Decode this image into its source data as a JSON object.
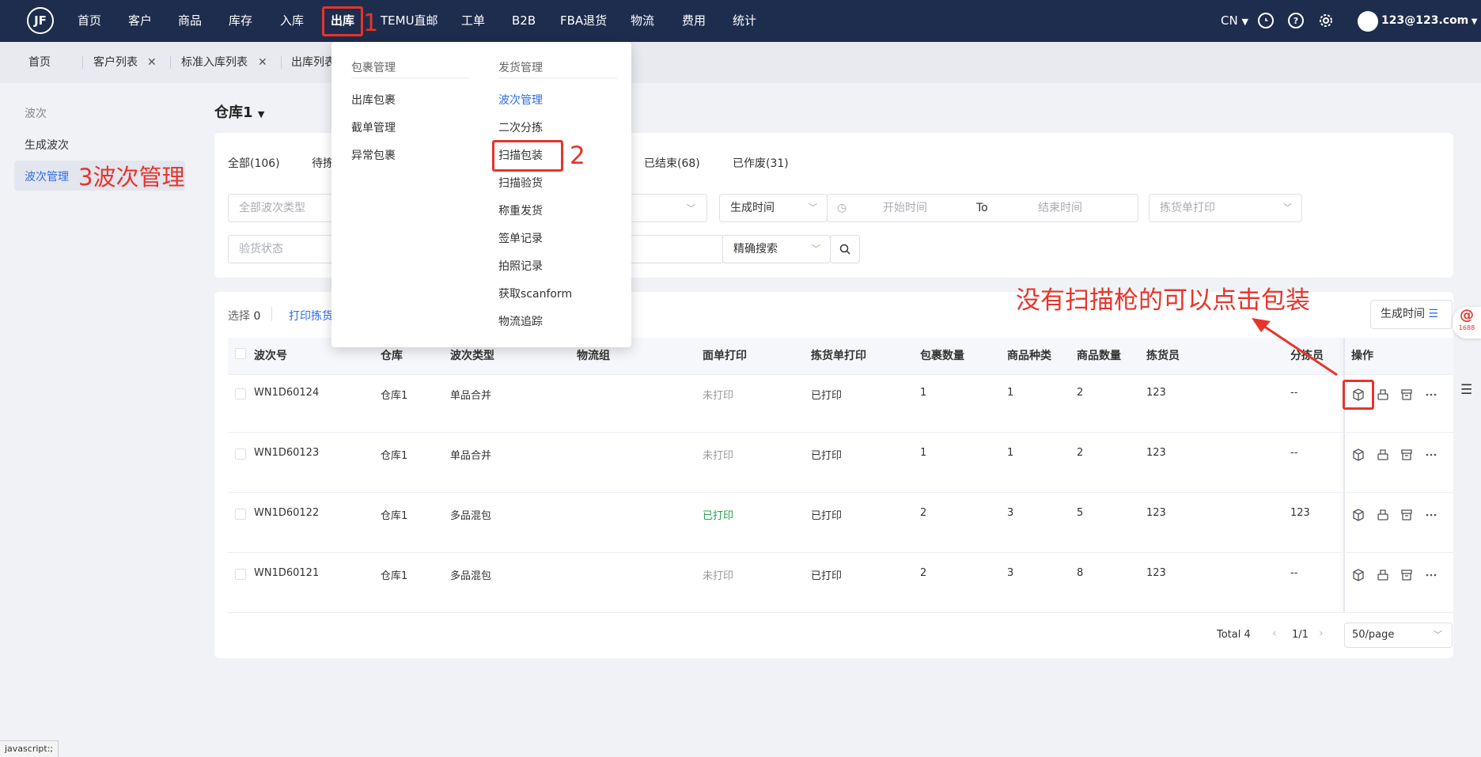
{
  "nav": {
    "logo_text": "JF",
    "items": [
      "首页",
      "客户",
      "商品",
      "库存",
      "入库",
      "出库",
      "TEMU直邮",
      "工单",
      "B2B",
      "FBA退货",
      "物流",
      "费用",
      "统计"
    ],
    "lang": "CN",
    "user": "123@123.com"
  },
  "tabs": [
    {
      "label": "首页",
      "closable": false
    },
    {
      "label": "客户列表",
      "closable": true
    },
    {
      "label": "标准入库列表",
      "closable": true
    },
    {
      "label": "出库列表",
      "closable": false
    }
  ],
  "sidebar": {
    "title": "波次",
    "items": [
      {
        "label": "生成波次",
        "active": false
      },
      {
        "label": "波次管理",
        "active": true
      }
    ]
  },
  "warehouse": "仓库1",
  "status_tabs": [
    "全部(106)",
    "待拣",
    "已结束(68)",
    "已作废(31)"
  ],
  "filters": {
    "wave_type_placeholder": "全部波次类型",
    "time_type": "生成时间",
    "start_placeholder": "开始时间",
    "to": "To",
    "end_placeholder": "结束时间",
    "pick_print_placeholder": "拣货单打印",
    "inspect_placeholder": "验货状态",
    "search_mode": "精确搜索"
  },
  "toolbar": {
    "select_label": "选择",
    "select_count": "0",
    "print_pick": "打印拣货",
    "sort_label": "生成时间"
  },
  "dropdown": {
    "col1": {
      "head": "包裹管理",
      "items": [
        "出库包裹",
        "截单管理",
        "异常包裹"
      ]
    },
    "col2": {
      "head": "发货管理",
      "items": [
        "波次管理",
        "二次分拣",
        "扫描包装",
        "扫描验货",
        "称重发货",
        "签单记录",
        "拍照记录",
        "获取scanform",
        "物流追踪"
      ]
    }
  },
  "table": {
    "headers": [
      "波次号",
      "仓库",
      "波次类型",
      "物流组",
      "面单打印",
      "拣货单打印",
      "包裹数量",
      "商品种类",
      "商品数量",
      "拣货员",
      "分拣员",
      "操作"
    ],
    "rows": [
      {
        "id": "WN1D60124",
        "warehouse": "仓库1",
        "type": "单品合并",
        "group": "",
        "label_print": "未打印",
        "label_status": "unprinted",
        "pick_print": "已打印",
        "packages": "1",
        "kinds": "1",
        "qty": "2",
        "picker": "123",
        "sorter": "--"
      },
      {
        "id": "WN1D60123",
        "warehouse": "仓库1",
        "type": "单品合并",
        "group": "",
        "label_print": "未打印",
        "label_status": "unprinted",
        "pick_print": "已打印",
        "packages": "1",
        "kinds": "1",
        "qty": "2",
        "picker": "123",
        "sorter": "--"
      },
      {
        "id": "WN1D60122",
        "warehouse": "仓库1",
        "type": "多品混包",
        "group": "",
        "label_print": "已打印",
        "label_status": "printed",
        "pick_print": "已打印",
        "packages": "2",
        "kinds": "3",
        "qty": "5",
        "picker": "123",
        "sorter": "123"
      },
      {
        "id": "WN1D60121",
        "warehouse": "仓库1",
        "type": "多品混包",
        "group": "",
        "label_print": "未打印",
        "label_status": "unprinted",
        "pick_print": "已打印",
        "packages": "2",
        "kinds": "3",
        "qty": "8",
        "picker": "123",
        "sorter": "--"
      }
    ]
  },
  "pagination": {
    "total": "Total 4",
    "page": "1/1",
    "per_page": "50/page"
  },
  "annotations": {
    "step1": "1",
    "step2": "2",
    "step3": "3波次管理",
    "note": "没有扫描枪的可以点击包装"
  },
  "status_bar": "javascript:;",
  "badge_1688": "1688",
  "colors": {
    "nav_bg": "#1e2d4d",
    "accent": "#2f6ce8",
    "annotation_red": "#e8342b",
    "printed_green": "#1ea34a"
  }
}
